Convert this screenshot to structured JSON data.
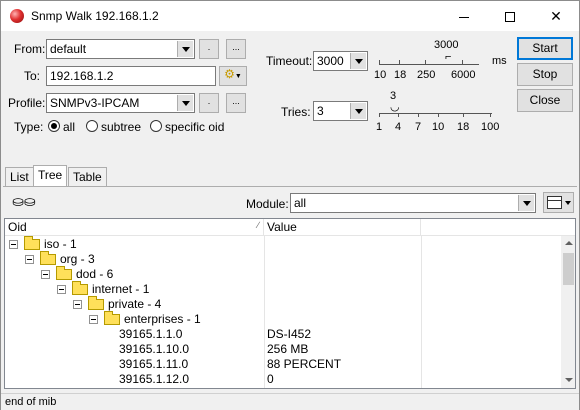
{
  "window": {
    "title": "Snmp Walk 192.168.1.2"
  },
  "form": {
    "from_label": "From:",
    "from_value": "default",
    "to_label": "To:",
    "to_value": "192.168.1.2",
    "profile_label": "Profile:",
    "profile_value": "SNMPv3-IPCAM",
    "type_label": "Type:",
    "type_options": [
      "all",
      "subtree",
      "specific oid"
    ],
    "type_selected": "all",
    "timeout_label": "Timeout:",
    "timeout_value": "3000",
    "tries_label": "Tries:",
    "tries_value": "3",
    "ellipsis": "...",
    "small_dot": "."
  },
  "timeout_slider": {
    "current": "3000",
    "unit": "ms",
    "ticks": [
      "10",
      "18",
      "250",
      "6000"
    ]
  },
  "tries_slider": {
    "current": "3",
    "ticks": [
      "1",
      "4",
      "7",
      "10",
      "18",
      "100"
    ]
  },
  "actions": {
    "start": "Start",
    "stop": "Stop",
    "close": "Close"
  },
  "tabs": [
    "List",
    "Tree",
    "Table"
  ],
  "active_tab": "Tree",
  "module": {
    "label": "Module:",
    "value": "all"
  },
  "grid": {
    "columns": [
      "Oid",
      "Value"
    ],
    "rows": [
      {
        "oid": "iso - 1",
        "value": "",
        "level": 0,
        "folder": true
      },
      {
        "oid": "org - 3",
        "value": "",
        "level": 1,
        "folder": true
      },
      {
        "oid": "dod - 6",
        "value": "",
        "level": 2,
        "folder": true
      },
      {
        "oid": "internet - 1",
        "value": "",
        "level": 3,
        "folder": true
      },
      {
        "oid": "private - 4",
        "value": "",
        "level": 4,
        "folder": true
      },
      {
        "oid": "enterprises - 1",
        "value": "",
        "level": 5,
        "folder": true
      },
      {
        "oid": "39165.1.1.0",
        "value": "DS-I452",
        "level": 6,
        "folder": false
      },
      {
        "oid": "39165.1.10.0",
        "value": "256 MB",
        "level": 6,
        "folder": false
      },
      {
        "oid": "39165.1.11.0",
        "value": "88 PERCENT",
        "level": 6,
        "folder": false
      },
      {
        "oid": "39165.1.12.0",
        "value": "0",
        "level": 6,
        "folder": false
      }
    ]
  },
  "status": "end of mib"
}
